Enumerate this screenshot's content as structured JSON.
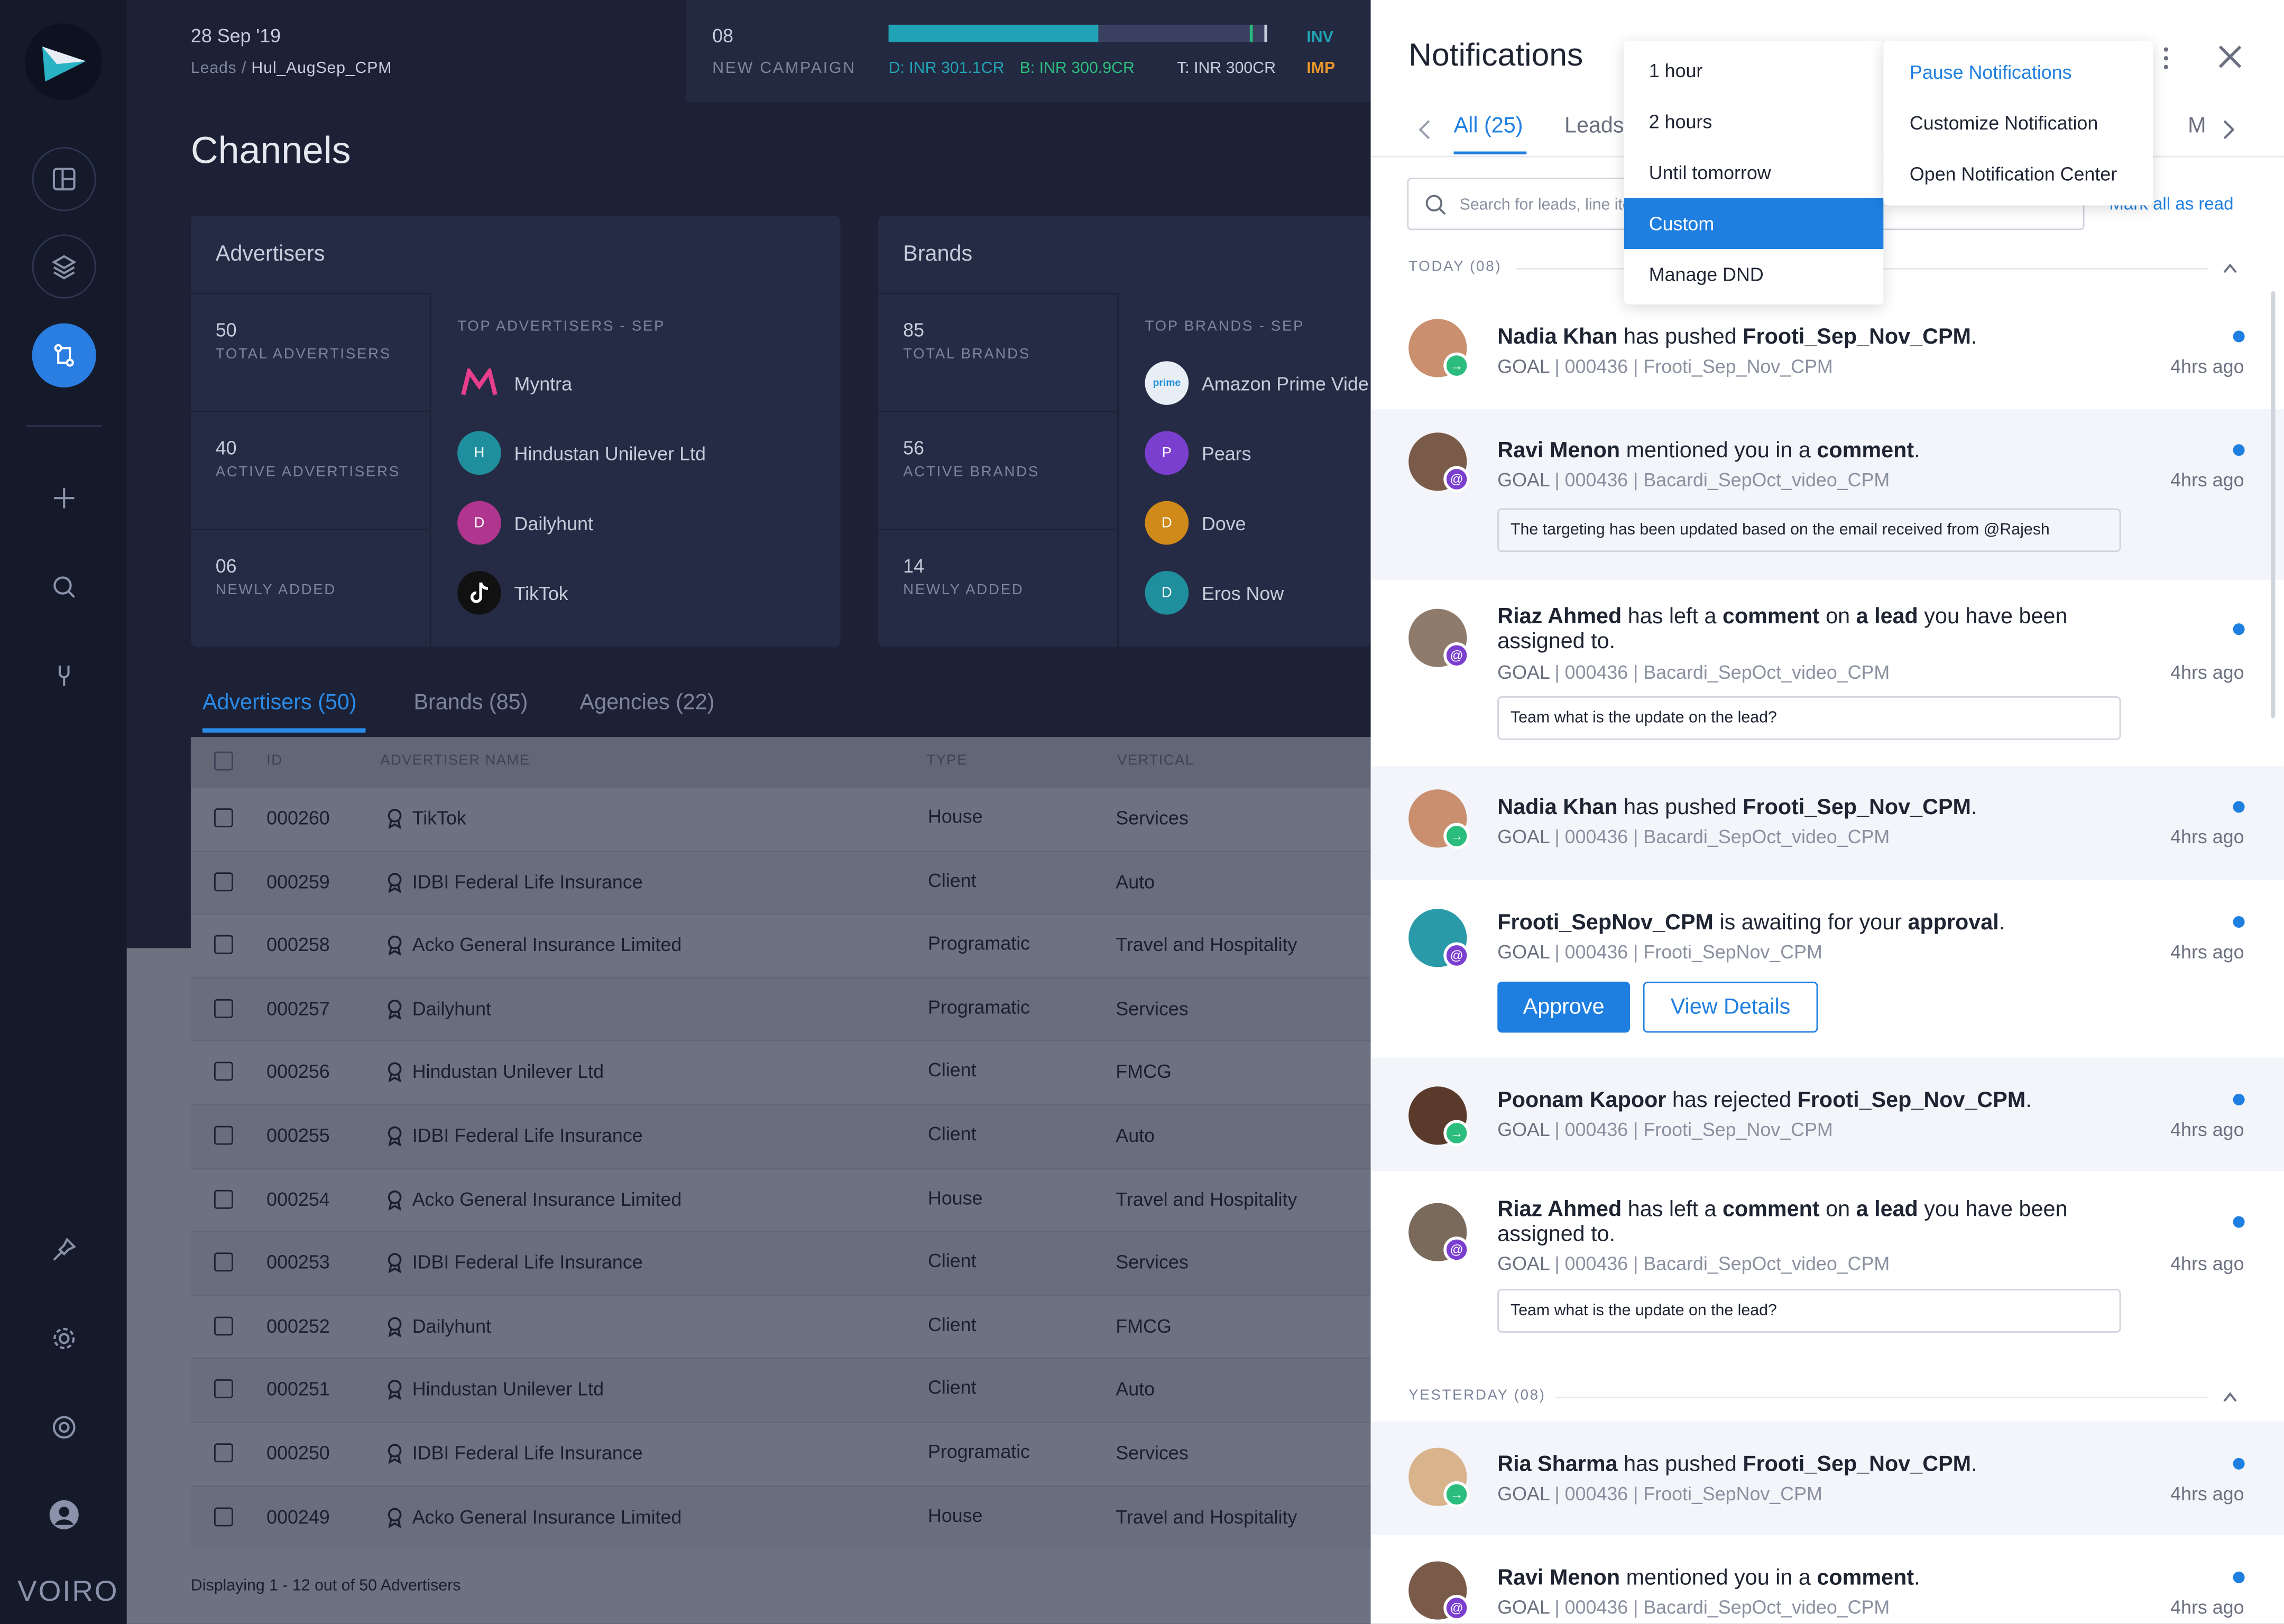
{
  "app": {
    "brand": "VOIRO"
  },
  "header": {
    "date": "28 Sep '19",
    "crumb_root": "Leads",
    "crumb_sep": " / ",
    "crumb_leaf": "Hul_AugSep_CPM",
    "campaign_count": "08",
    "campaign_label": "NEW CAMPAIGN",
    "campaign_progress_pct": 56,
    "budget_d": "D: INR 301.1CR",
    "budget_b": "B: INR 300.9CR",
    "budget_t": "T: INR 300CR",
    "inv_label": "INV",
    "imp_label": "IMP",
    "colors": {
      "d": "#20a3b4",
      "b": "#2bbd7e",
      "t": "#c7ccdb"
    }
  },
  "page_title": "Channels",
  "advertisers_card": {
    "title": "Advertisers",
    "stats": [
      {
        "value": "50",
        "label": "TOTAL ADVERTISERS"
      },
      {
        "value": "40",
        "label": "ACTIVE ADVERTISERS"
      },
      {
        "value": "06",
        "label": "NEWLY ADDED"
      }
    ],
    "top_label": "TOP ADVERTISERS - SEP",
    "top": [
      {
        "name": "Myntra",
        "initial": "",
        "color": "#1c2135"
      },
      {
        "name": "Hindustan Unilever Ltd",
        "initial": "H",
        "color": "#1f8f9e"
      },
      {
        "name": "Dailyhunt",
        "initial": "D",
        "color": "#b0358f"
      },
      {
        "name": "TikTok",
        "initial": "",
        "color": "#111111"
      }
    ]
  },
  "brands_card": {
    "title": "Brands",
    "stats": [
      {
        "value": "85",
        "label": "TOTAL BRANDS"
      },
      {
        "value": "56",
        "label": "ACTIVE BRANDS"
      },
      {
        "value": "14",
        "label": "NEWLY ADDED"
      }
    ],
    "top_label": "TOP BRANDS - SEP",
    "top": [
      {
        "name": "Amazon Prime Vide",
        "initial": "",
        "color": "#e8eef5"
      },
      {
        "name": "Pears",
        "initial": "P",
        "color": "#7b3fd0"
      },
      {
        "name": "Dove",
        "initial": "D",
        "color": "#d08a1a"
      },
      {
        "name": "Eros Now",
        "initial": "D",
        "color": "#1f8f9e"
      }
    ]
  },
  "list_tabs": [
    {
      "label": "Advertisers (50)",
      "active": true
    },
    {
      "label": "Brands (85)",
      "active": false
    },
    {
      "label": "Agencies (22)",
      "active": false
    }
  ],
  "table": {
    "columns": [
      "ID",
      "ADVERTISER NAME",
      "TYPE",
      "VERTICAL"
    ],
    "rows": [
      {
        "id": "000260",
        "name": "TikTok",
        "type": "House",
        "vertical": "Services"
      },
      {
        "id": "000259",
        "name": "IDBI Federal Life Insurance",
        "type": "Client",
        "vertical": "Auto"
      },
      {
        "id": "000258",
        "name": "Acko General Insurance Limited",
        "type": "Programatic",
        "vertical": "Travel and Hospitality"
      },
      {
        "id": "000257",
        "name": "Dailyhunt",
        "type": "Programatic",
        "vertical": "Services"
      },
      {
        "id": "000256",
        "name": "Hindustan Unilever Ltd",
        "type": "Client",
        "vertical": "FMCG"
      },
      {
        "id": "000255",
        "name": "IDBI Federal Life Insurance",
        "type": "Client",
        "vertical": "Auto"
      },
      {
        "id": "000254",
        "name": "Acko General Insurance Limited",
        "type": "House",
        "vertical": "Travel and Hospitality"
      },
      {
        "id": "000253",
        "name": "IDBI Federal Life Insurance",
        "type": "Client",
        "vertical": "Services"
      },
      {
        "id": "000252",
        "name": "Dailyhunt",
        "type": "Client",
        "vertical": "FMCG"
      },
      {
        "id": "000251",
        "name": "Hindustan Unilever Ltd",
        "type": "Client",
        "vertical": "Auto"
      },
      {
        "id": "000250",
        "name": "IDBI Federal Life Insurance",
        "type": "Programatic",
        "vertical": "Services"
      },
      {
        "id": "000249",
        "name": "Acko General Insurance Limited",
        "type": "House",
        "vertical": "Travel and Hospitality"
      }
    ],
    "footer": "Displaying 1 - 12 out of 50 Advertisers"
  },
  "notifications": {
    "title": "Notifications",
    "tabs": [
      {
        "label": "All (25)",
        "active": true
      },
      {
        "label": "Leads",
        "active": false
      },
      {
        "label": "M",
        "active": false
      }
    ],
    "search_placeholder": "Search for leads, line ite",
    "mark_all": "Mark all as read",
    "sections": [
      {
        "label": "TODAY (08)"
      },
      {
        "label": "YESTERDAY (08)"
      }
    ],
    "items": [
      {
        "actor": "Nadia Khan",
        "verb": " has pushed ",
        "object": "Frooti_Sep_Nov_CPM",
        "tail": ".",
        "meta_goal": "GOAL",
        "meta": " | 000436 | Frooti_Sep_Nov_CPM",
        "time": "4hrs ago",
        "badge": "green"
      },
      {
        "actor": "Ravi Menon",
        "verb": " mentioned you in a ",
        "object": "comment",
        "tail": ".",
        "meta_goal": "GOAL",
        "meta": " | 000436 | Bacardi_SepOct_video_CPM",
        "time": "4hrs ago",
        "badge": "purple",
        "quote": "The targeting has been updated based on the email received from @Rajesh"
      },
      {
        "actor": "Riaz Ahmed",
        "verb": " has left a ",
        "object": "comment",
        "mid": " on ",
        "object2": "a lead",
        "tail": " you have been assigned to.",
        "meta_goal": "GOAL",
        "meta": " | 000436 | Bacardi_SepOct_video_CPM",
        "time": "4hrs ago",
        "badge": "purple",
        "quote": "Team what is the update on the lead?"
      },
      {
        "actor": "Nadia Khan",
        "verb": " has pushed ",
        "object": "Frooti_Sep_Nov_CPM",
        "tail": ".",
        "meta_goal": "GOAL",
        "meta": " | 000436 | Bacardi_SepOct_video_CPM",
        "time": "4hrs ago",
        "badge": "green"
      },
      {
        "actor": "Frooti_SepNov_CPM",
        "verb": " is awaiting for your ",
        "object": "approval",
        "tail": ".",
        "meta_goal": "GOAL",
        "meta": " | 000436 | Frooti_SepNov_CPM",
        "time": "4hrs ago",
        "badge": "purple",
        "approve": "Approve",
        "view": "View Details"
      },
      {
        "actor": "Poonam Kapoor",
        "verb": " has rejected ",
        "object": "Frooti_Sep_Nov_CPM",
        "tail": ".",
        "meta_goal": "GOAL",
        "meta": " | 000436 | Frooti_Sep_Nov_CPM",
        "time": "4hrs ago",
        "badge": "green"
      },
      {
        "actor": "Riaz Ahmed",
        "verb": " has left a ",
        "object": "comment",
        "mid": " on ",
        "object2": "a lead",
        "tail": " you have been assigned to.",
        "meta_goal": "GOAL",
        "meta": " | 000436 | Bacardi_SepOct_video_CPM",
        "time": "4hrs ago",
        "badge": "purple",
        "quote": "Team what is the update on the lead?"
      },
      {
        "actor": "Ria Sharma",
        "verb": " has pushed ",
        "object": "Frooti_Sep_Nov_CPM",
        "tail": ".",
        "meta_goal": "GOAL",
        "meta": " | 000436 | Frooti_SepNov_CPM",
        "time": "4hrs ago",
        "badge": "green"
      },
      {
        "actor": "Ravi Menon",
        "verb": " mentioned you in a ",
        "object": "comment",
        "tail": ".",
        "meta_goal": "GOAL",
        "meta": " | 000436 | Bacardi_SepOct_video_CPM",
        "time": "4hrs ago",
        "badge": "purple"
      }
    ]
  },
  "dnd_menu": {
    "options": [
      "1 hour",
      "2 hours",
      "Until tomorrow",
      "Custom",
      "Manage DND"
    ],
    "selected": "Custom"
  },
  "more_menu": {
    "options": [
      "Pause Notifications",
      "Customize Notification",
      "Open Notification Center"
    ]
  },
  "colors": {
    "accent": "#1e7fe0",
    "badge_green": "#2bbd7e",
    "badge_purple": "#7b3fd0"
  }
}
